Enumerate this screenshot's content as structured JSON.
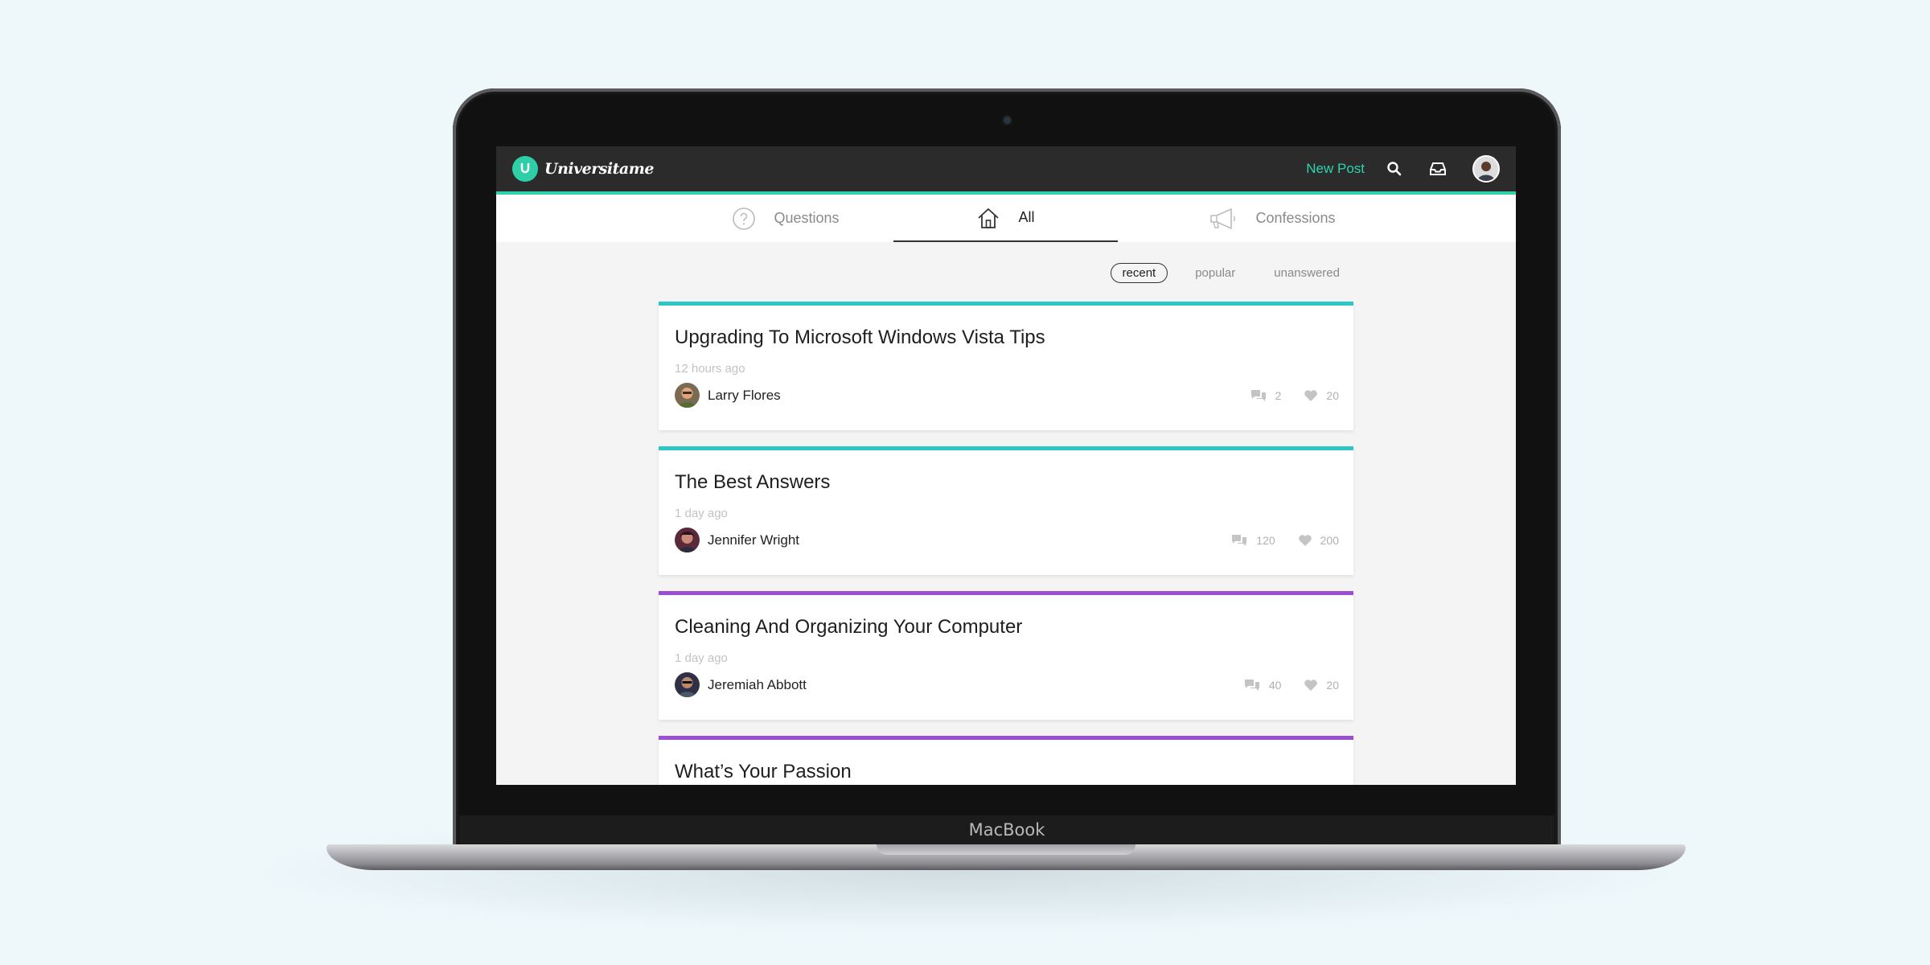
{
  "device": {
    "label": "MacBook"
  },
  "app": {
    "name": "Universitame",
    "new_post_label": "New Post"
  },
  "tabs": [
    {
      "label": "Questions",
      "icon": "question-icon",
      "active": false
    },
    {
      "label": "All",
      "icon": "home-icon",
      "active": true
    },
    {
      "label": "Confessions",
      "icon": "megaphone-icon",
      "active": false
    }
  ],
  "filters": [
    {
      "label": "recent",
      "active": true
    },
    {
      "label": "popular",
      "active": false
    },
    {
      "label": "unanswered",
      "active": false
    }
  ],
  "posts": [
    {
      "title": "Upgrading To Microsoft Windows Vista Tips",
      "time": "12 hours ago",
      "author": "Larry Flores",
      "comments": "2",
      "likes": "20",
      "accent": "#2ec7c7"
    },
    {
      "title": "The Best Answers",
      "time": "1 day ago",
      "author": "Jennifer Wright",
      "comments": "120",
      "likes": "200",
      "accent": "#2ec7c7"
    },
    {
      "title": "Cleaning And Organizing Your Computer",
      "time": "1 day ago",
      "author": "Jeremiah Abbott",
      "comments": "40",
      "likes": "20",
      "accent": "#9b4fd0"
    },
    {
      "title": "What’s Your Passion",
      "time": "",
      "author": "",
      "comments": "",
      "likes": "",
      "accent": "#9b4fd0"
    }
  ],
  "colors": {
    "accent_green": "#2ed3ad",
    "topbar": "#2b2b2b",
    "teal": "#2ec7c7",
    "purple": "#9b4fd0"
  }
}
